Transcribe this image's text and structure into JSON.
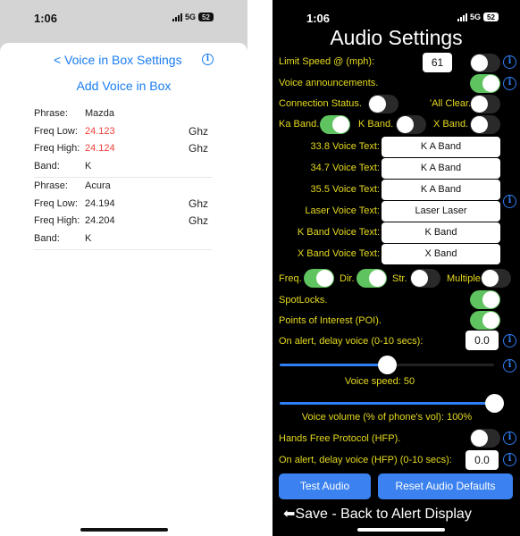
{
  "left": {
    "status": {
      "time": "1:06",
      "network": "5G",
      "battery": "52"
    },
    "nav": {
      "back_label": "< Voice in Box Settings",
      "info_icon": "info-icon"
    },
    "add_button": "Add Voice in Box",
    "entries": [
      {
        "phrase_label": "Phrase:",
        "phrase": "Mazda",
        "low_label": "Freq Low:",
        "low": "24.123",
        "high_label": "Freq High:",
        "high": "24.124",
        "band_label": "Band:",
        "band": "K",
        "unit": "Ghz",
        "highlight": true
      },
      {
        "phrase_label": "Phrase:",
        "phrase": "Acura",
        "low_label": "Freq Low:",
        "low": "24.194",
        "high_label": "Freq High:",
        "high": "24.204",
        "band_label": "Band:",
        "band": "K",
        "unit": "Ghz",
        "highlight": false
      }
    ]
  },
  "right": {
    "status": {
      "time": "1:06",
      "network": "5G",
      "battery": "52"
    },
    "title": "Audio Settings",
    "limit_speed": {
      "label": "Limit Speed @ (mph):",
      "value": "61",
      "enabled": false
    },
    "voice_announcements": {
      "label": "Voice announcements.",
      "enabled": true
    },
    "connection_status": {
      "label": "Connection Status.",
      "enabled": false
    },
    "all_clear": {
      "label": "'All Clear.'",
      "enabled": false
    },
    "ka_band": {
      "label": "Ka Band.",
      "enabled": true
    },
    "k_band": {
      "label": "K Band.",
      "enabled": false
    },
    "x_band": {
      "label": "X Band.",
      "enabled": false
    },
    "voice_texts": [
      {
        "label": "33.8 Voice Text:",
        "value": "K A Band"
      },
      {
        "label": "34.7 Voice Text:",
        "value": "K A Band"
      },
      {
        "label": "35.5 Voice Text:",
        "value": "K A Band"
      },
      {
        "label": "Laser Voice Text:",
        "value": "Laser Laser"
      },
      {
        "label": "K Band Voice Text:",
        "value": "K Band"
      },
      {
        "label": "X Band Voice Text:",
        "value": "X Band"
      }
    ],
    "freq": {
      "label": "Freq.",
      "enabled": true
    },
    "dir": {
      "label": "Dir.",
      "enabled": true
    },
    "str": {
      "label": "Str.",
      "enabled": false
    },
    "multiple": {
      "label": "Multiple.",
      "enabled": false
    },
    "spotlocks": {
      "label": "SpotLocks.",
      "enabled": true
    },
    "poi": {
      "label": "Points of Interest (POI).",
      "enabled": true
    },
    "delay_voice": {
      "label": "On alert, delay voice (0-10 secs):",
      "value": "0.0"
    },
    "voice_speed": {
      "label": "Voice speed: 50",
      "fraction": 0.5
    },
    "voice_volume": {
      "label": "Voice volume (% of phone's vol): 100%",
      "fraction": 1.0
    },
    "hfp": {
      "label": "Hands Free Protocol (HFP).",
      "enabled": false
    },
    "delay_voice_hfp": {
      "label": "On alert, delay voice (HFP) (0-10 secs):",
      "value": "0.0"
    },
    "buttons": {
      "test_audio": "Test Audio",
      "reset_defaults": "Reset Audio Defaults"
    },
    "save_back": "Save - Back to Alert Display",
    "info_glyph": "i"
  }
}
